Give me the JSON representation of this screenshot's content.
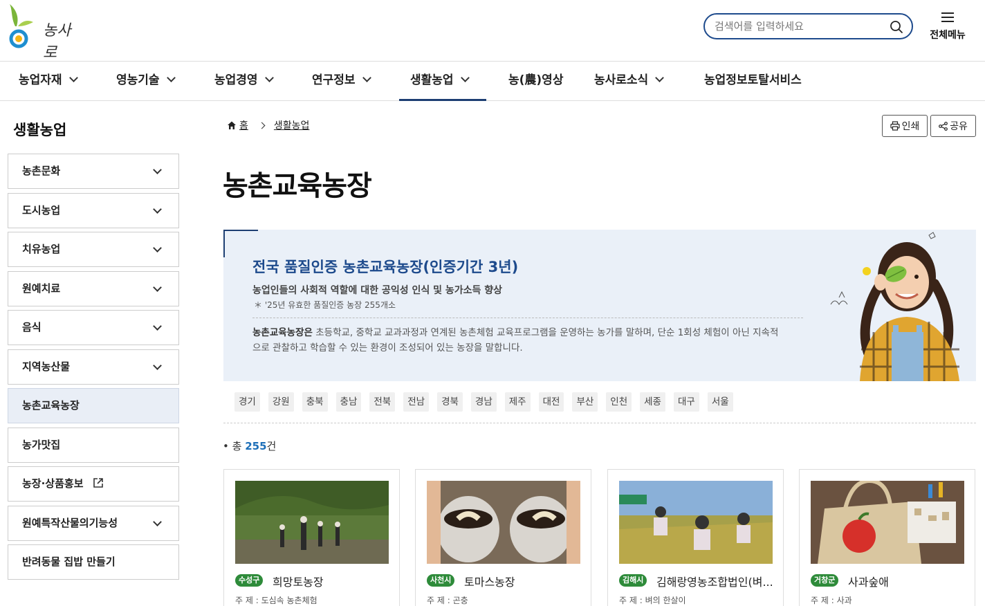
{
  "header": {
    "logo_text": "농사로",
    "search_placeholder": "검색어를 입력하세요",
    "allmenu_label": "전체메뉴"
  },
  "gnb": [
    {
      "label": "농업자재",
      "has_sub": true
    },
    {
      "label": "영농기술",
      "has_sub": true
    },
    {
      "label": "농업경영",
      "has_sub": true
    },
    {
      "label": "연구정보",
      "has_sub": true
    },
    {
      "label": "생활농업",
      "has_sub": true,
      "active": true
    },
    {
      "label": "농(農)영상",
      "has_sub": false
    },
    {
      "label": "농사로소식",
      "has_sub": true
    },
    {
      "label": "농업정보토탈서비스",
      "has_sub": false
    }
  ],
  "lnb": {
    "title": "생활농업",
    "items": [
      {
        "label": "농촌문화"
      },
      {
        "label": "도시농업"
      },
      {
        "label": "치유농업"
      },
      {
        "label": "원예치료"
      },
      {
        "label": "음식"
      },
      {
        "label": "지역농산물"
      },
      {
        "label": "농촌교육농장"
      },
      {
        "label": "농가맛집"
      },
      {
        "label": "농장·상품홍보"
      },
      {
        "label": "원예특작산물의기능성"
      },
      {
        "label": "반려동물 집밥 만들기"
      }
    ]
  },
  "breadcrumb": {
    "home": "홈",
    "current": "생활농업"
  },
  "buttons": {
    "print": "인쇄",
    "share": "공유"
  },
  "page_title": "농촌교육농장",
  "banner": {
    "title": "전국 품질인증 농촌교육농장(인증기간 3년)",
    "subtitle": "농업인들의 사회적 역할에 대한 공익성 인식 및 농가소득 향상",
    "note": "＊ '25년 유효한 품질인증 농장 255개소",
    "desc_bold": "농촌교육농장은",
    "desc_rest": " 초등학교, 중학교 교과과정과 연계된 농촌체험 교육프로그램을 운영하는 농가를 말하며, 단순 1회성 체험이 아닌 지속적으로 관찰하고 학습할 수 있는 환경이 조성되어 있는 농장을 말합니다."
  },
  "regions": [
    "경기",
    "강원",
    "충북",
    "충남",
    "전북",
    "전남",
    "경북",
    "경남",
    "제주",
    "대전",
    "부산",
    "인천",
    "세종",
    "대구",
    "서울"
  ],
  "total": {
    "prefix": "총 ",
    "count": "255",
    "suffix": "건"
  },
  "cards": [
    {
      "badge": "수성구",
      "name": "희망토농장",
      "theme": "주 제 : 도심속 농촌체험"
    },
    {
      "badge": "사천시",
      "name": "토마스농장",
      "theme": "주 제 : 곤충"
    },
    {
      "badge": "김해시",
      "name": "김해랑영농조합법인(벼...",
      "theme": "주 제 : 벼의 한살이"
    },
    {
      "badge": "거창군",
      "name": "사과숲애",
      "theme": "주 제 : 사과"
    }
  ],
  "colors": {
    "brand": "#1d3e72",
    "accent": "#1d4a8c",
    "badge": "#2e8b3a",
    "banner_bg": "#eaf0f8"
  }
}
